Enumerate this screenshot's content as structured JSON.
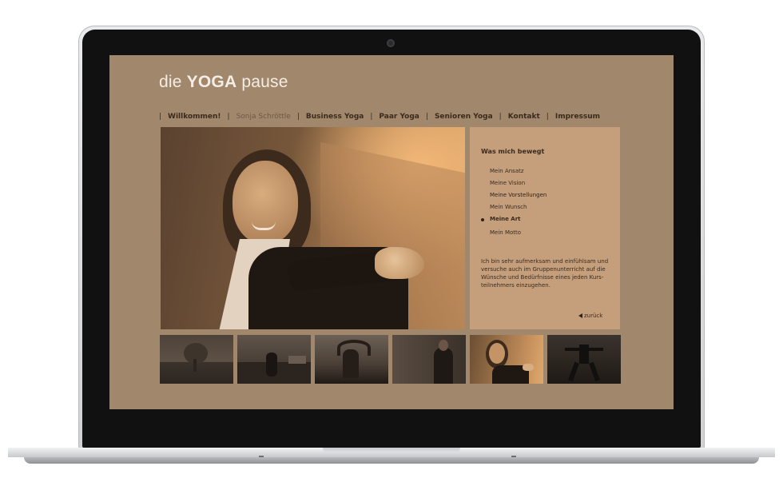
{
  "site": {
    "logo_prefix": "die",
    "logo_bold": "YOGA",
    "logo_suffix": "pause"
  },
  "nav": {
    "separator": "|",
    "items": [
      {
        "label": "Willkommen!"
      },
      {
        "label": "Sonja Schröttle",
        "active": true
      },
      {
        "label": "Business Yoga"
      },
      {
        "label": "Paar Yoga"
      },
      {
        "label": "Senioren Yoga"
      },
      {
        "label": "Kontakt"
      },
      {
        "label": "Impressum"
      }
    ]
  },
  "panel": {
    "title": "Was mich bewegt",
    "menu": [
      {
        "label": "Mein Ansatz"
      },
      {
        "label": "Meine Vision"
      },
      {
        "label": "Meine Vorstellungen"
      },
      {
        "label": "Mein Wunsch"
      },
      {
        "label": "Meine Art",
        "current": true
      },
      {
        "label": "Mein Motto"
      }
    ],
    "text": "Ich bin sehr aufmerksam und einfühlsam und versuche auch im Gruppenunterricht auf die Wünsche und Bedürfnisse eines jeden Kurs-teilnehmers einzugehen.",
    "back_label": "zurück"
  },
  "gallery": {
    "count": 6,
    "selected_index": 5
  },
  "colors": {
    "page_bg": "#a1876c",
    "panel_bg": "#c59f7c",
    "nav_text": "#3a2b1e",
    "nav_active": "#6e5a45",
    "logo_text": "#f4ede4"
  }
}
